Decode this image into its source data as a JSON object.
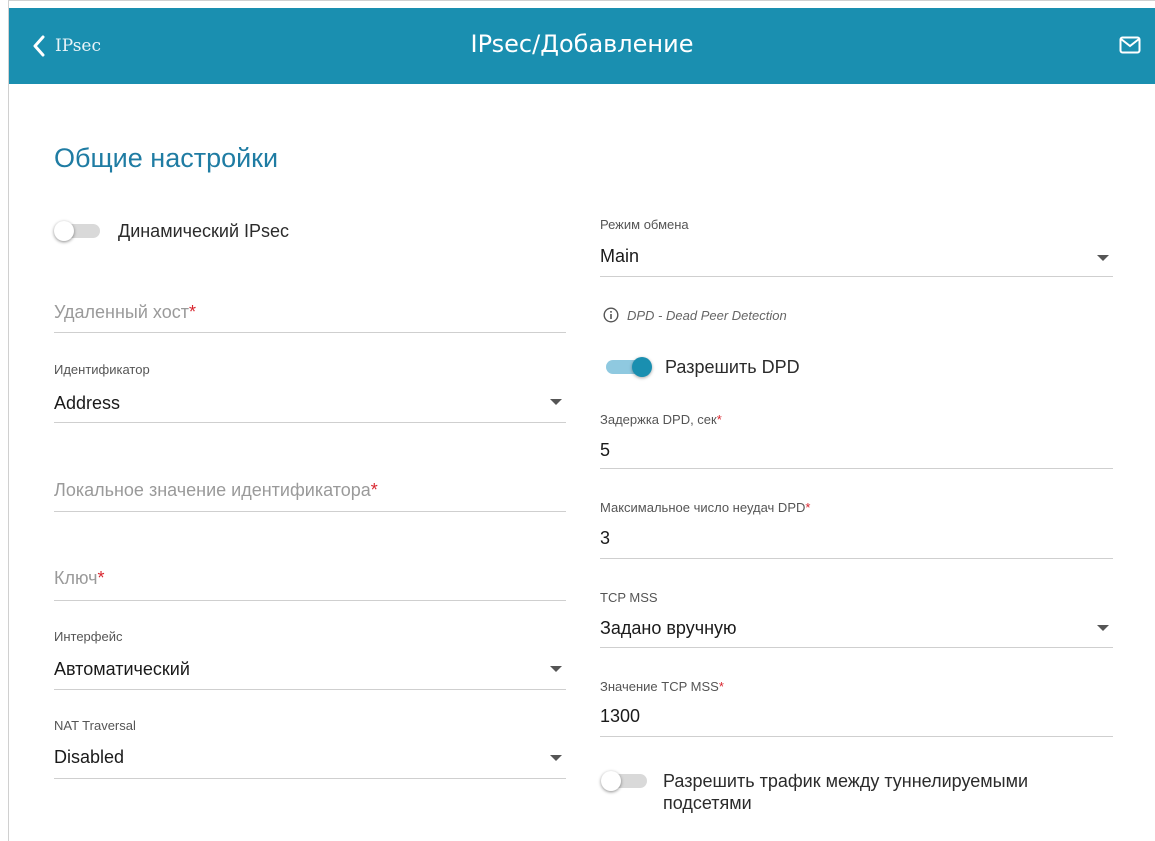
{
  "header": {
    "back_label": "IPsec",
    "title": "IPsec/Добавление",
    "color": "#1a8fb0"
  },
  "section_title": "Общие настройки",
  "left": {
    "dynamic_ipsec": {
      "label": "Динамический IPsec",
      "enabled": false
    },
    "remote_host": {
      "placeholder": "Удаленный хост",
      "required": "*"
    },
    "identifier": {
      "label": "Идентификатор",
      "value": "Address"
    },
    "local_id": {
      "placeholder": "Локальное значение идентификатора",
      "required": "*"
    },
    "key": {
      "placeholder": "Ключ",
      "required": "*"
    },
    "interface": {
      "label": "Интерфейс",
      "value": "Автоматический"
    },
    "nat_traversal": {
      "label": "NAT Traversal",
      "value": "Disabled"
    }
  },
  "right": {
    "exchange_mode": {
      "label": "Режим обмена",
      "value": "Main"
    },
    "dpd_info": "DPD - Dead Peer Detection",
    "enable_dpd": {
      "label": "Разрешить DPD",
      "enabled": true
    },
    "dpd_delay": {
      "label": "Задержка DPD, сек",
      "required": "*",
      "value": "5"
    },
    "dpd_max_fail": {
      "label": "Максимальное число неудач DPD",
      "required": "*",
      "value": "3"
    },
    "tcp_mss": {
      "label": "TCP MSS",
      "value": "Задано вручную"
    },
    "tcp_mss_value": {
      "label": "Значение TCP MSS",
      "required": "*",
      "value": "1300"
    },
    "allow_traffic": {
      "label_line1": "Разрешить трафик между туннелируемыми",
      "label_line2": "подсетями",
      "enabled": false
    }
  },
  "icons": {
    "back": "chevron-left-icon",
    "mail": "mail-icon",
    "info": "info-icon"
  }
}
